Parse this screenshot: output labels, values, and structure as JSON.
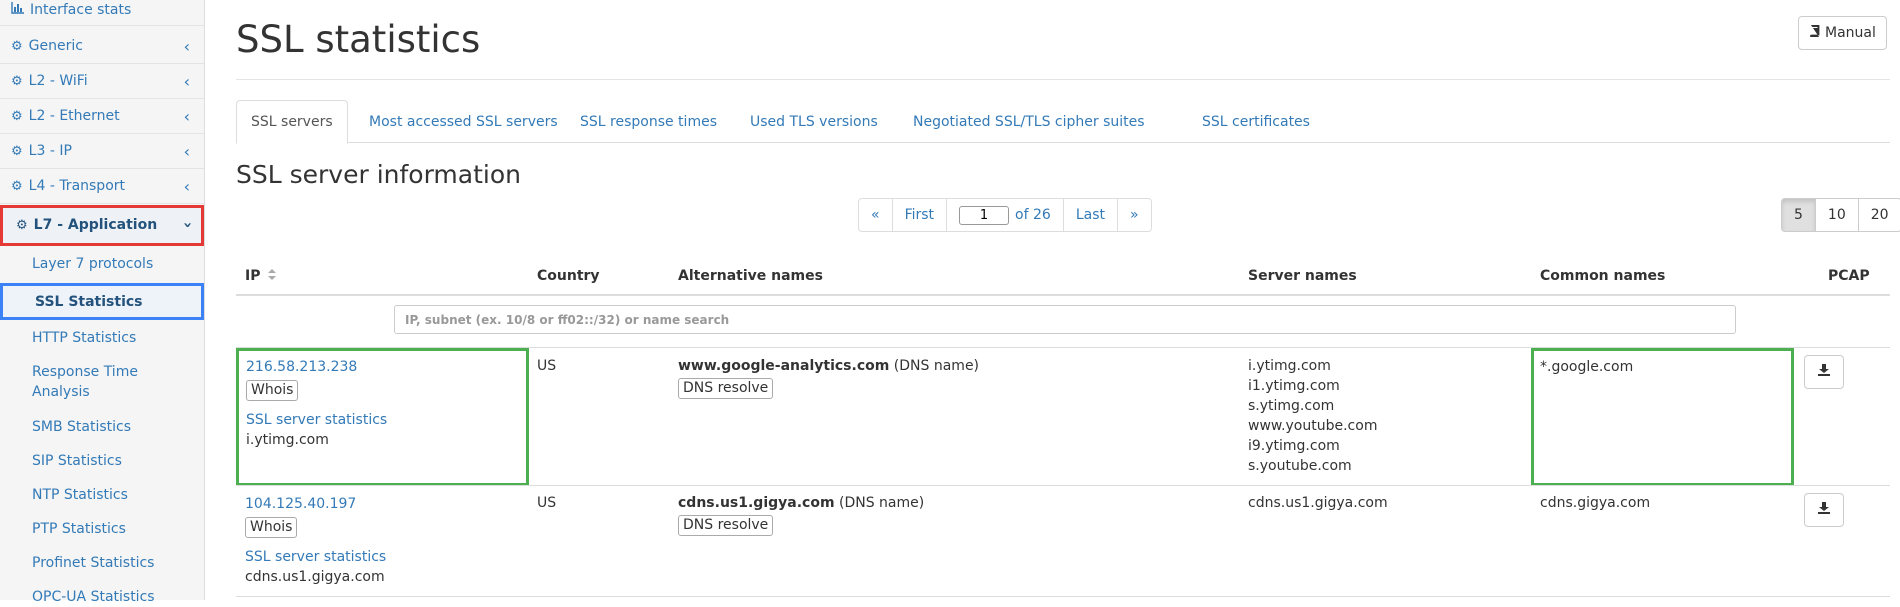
{
  "sidebar": {
    "interface_stats": "Interface stats",
    "sections": [
      {
        "label": "Generic"
      },
      {
        "label": "L2 - WiFi"
      },
      {
        "label": "L2 - Ethernet"
      },
      {
        "label": "L3 - IP"
      },
      {
        "label": "L4 - Transport"
      }
    ],
    "active_section": "L7 - Application",
    "sub_items": {
      "layer7": "Layer 7 protocols",
      "ssl": "SSL Statistics",
      "http": "HTTP Statistics",
      "response_time": "Response Time Analysis",
      "smb": "SMB Statistics",
      "sip": "SIP Statistics",
      "ntp": "NTP Statistics",
      "ptp": "PTP Statistics",
      "profinet": "Profinet Statistics",
      "opcua": "OPC-UA Statistics"
    }
  },
  "header": {
    "title": "SSL statistics",
    "manual_label": "Manual"
  },
  "tabs": [
    {
      "label": "SSL servers"
    },
    {
      "label": "Most accessed SSL servers"
    },
    {
      "label": "SSL response times"
    },
    {
      "label": "Used TLS versions"
    },
    {
      "label": "Negotiated SSL/TLS cipher suites"
    },
    {
      "label": "SSL certificates"
    }
  ],
  "section_title": "SSL server information",
  "pagination": {
    "prev": "«",
    "first": "First",
    "page": "1",
    "of_label": "of 26",
    "last": "Last",
    "next": "»",
    "page_sizes": [
      "5",
      "10",
      "20"
    ]
  },
  "table": {
    "columns": {
      "ip": "IP",
      "country": "Country",
      "alt_names": "Alternative names",
      "server_names": "Server names",
      "common_names": "Common names",
      "pcap": "PCAP"
    },
    "search_placeholder": "IP, subnet (ex. 10/8 or ff02::/32) or name search",
    "whois_label": "Whois",
    "ssl_link_label": "SSL server statistics",
    "dns_resolve_label": "DNS resolve",
    "dns_name_suffix": "(DNS name)",
    "rows": [
      {
        "ip": "216.58.213.238",
        "ip_name": "i.ytimg.com",
        "country": "US",
        "alt_name": "www.google-analytics.com",
        "server_names": [
          "i.ytimg.com",
          "i1.ytimg.com",
          "s.ytimg.com",
          "www.youtube.com",
          "i9.ytimg.com",
          "s.youtube.com"
        ],
        "common_name": "*.google.com"
      },
      {
        "ip": "104.125.40.197",
        "ip_name": "cdns.us1.gigya.com",
        "country": "US",
        "alt_name": "cdns.us1.gigya.com",
        "server_names": [
          "cdns.us1.gigya.com"
        ],
        "common_name": "cdns.gigya.com"
      }
    ]
  }
}
